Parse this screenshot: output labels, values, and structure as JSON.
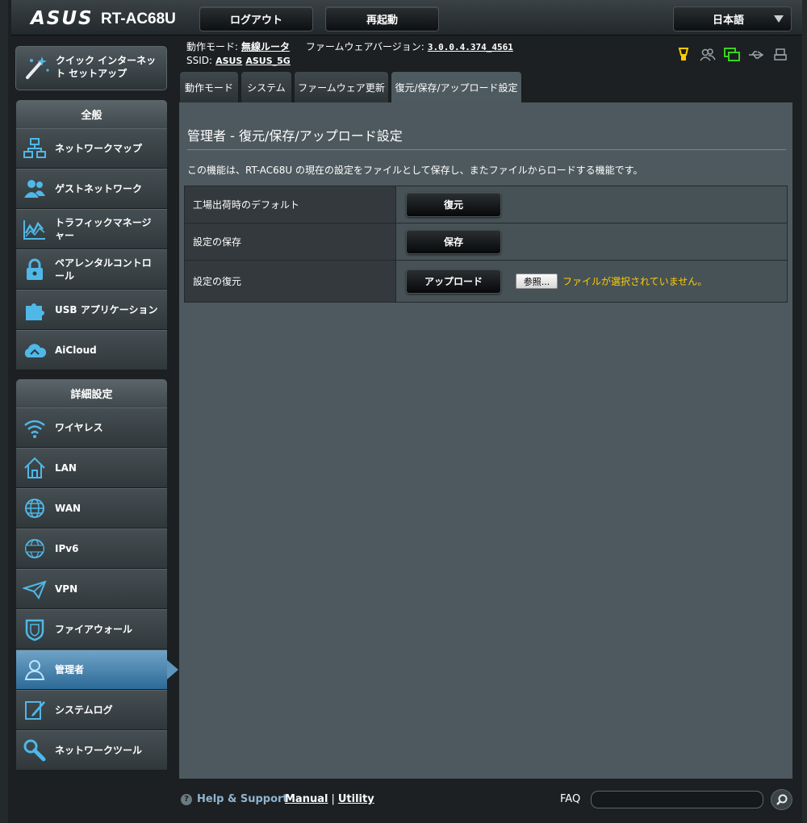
{
  "header": {
    "logo": "ASUS",
    "model": "RT-AC68U",
    "logout_label": "ログアウト",
    "reboot_label": "再起動",
    "language": "日本語"
  },
  "info": {
    "mode_label": "動作モード:",
    "mode_value": "無線ルータ",
    "firmware_label": "ファームウェアバージョン:",
    "firmware_value": "3.0.0.4.374_4561",
    "ssid_label": "SSID:",
    "ssid_1": "ASUS",
    "ssid_2": "ASUS_5G"
  },
  "status_icons": [
    "notification-icon",
    "clients-icon",
    "network-status-icon",
    "usb-icon",
    "printer-icon"
  ],
  "colors": {
    "accent": "#5c95bd",
    "warning": "#ffcc00",
    "icon_blue": "#4fb8e8",
    "icon_green": "#39d21e"
  },
  "tabs": [
    {
      "label": "動作モード"
    },
    {
      "label": "システム"
    },
    {
      "label": "ファームウェア更新"
    },
    {
      "label": "復元/保存/アップロード設定"
    }
  ],
  "sidebar": {
    "quick_setup": "クイック インターネット セットアップ",
    "general_header": "全般",
    "general_items": [
      {
        "label": "ネットワークマップ"
      },
      {
        "label": "ゲストネットワーク"
      },
      {
        "label": "トラフィックマネージャー"
      },
      {
        "label": "ペアレンタルコントロール"
      },
      {
        "label": "USB アプリケーション"
      },
      {
        "label": "AiCloud"
      }
    ],
    "advanced_header": "詳細設定",
    "advanced_items": [
      {
        "label": "ワイヤレス"
      },
      {
        "label": "LAN"
      },
      {
        "label": "WAN"
      },
      {
        "label": "IPv6"
      },
      {
        "label": "VPN"
      },
      {
        "label": "ファイアウォール"
      },
      {
        "label": "管理者"
      },
      {
        "label": "システムログ"
      },
      {
        "label": "ネットワークツール"
      }
    ]
  },
  "main": {
    "title": "管理者 - 復元/保存/アップロード設定",
    "description": "この機能は、RT-AC68U の現在の設定をファイルとして保存し、またファイルからロードする機能です。",
    "rows": [
      {
        "label": "工場出荷時のデフォルト",
        "button": "復元"
      },
      {
        "label": "設定の保存",
        "button": "保存"
      },
      {
        "label": "設定の復元",
        "button": "アップロード",
        "browse": "参照...",
        "no_file": "ファイルが選択されていません。"
      }
    ]
  },
  "footer": {
    "help": "Help & Support",
    "manual": "Manual",
    "separator": "|",
    "utility": "Utility",
    "faq": "FAQ"
  }
}
